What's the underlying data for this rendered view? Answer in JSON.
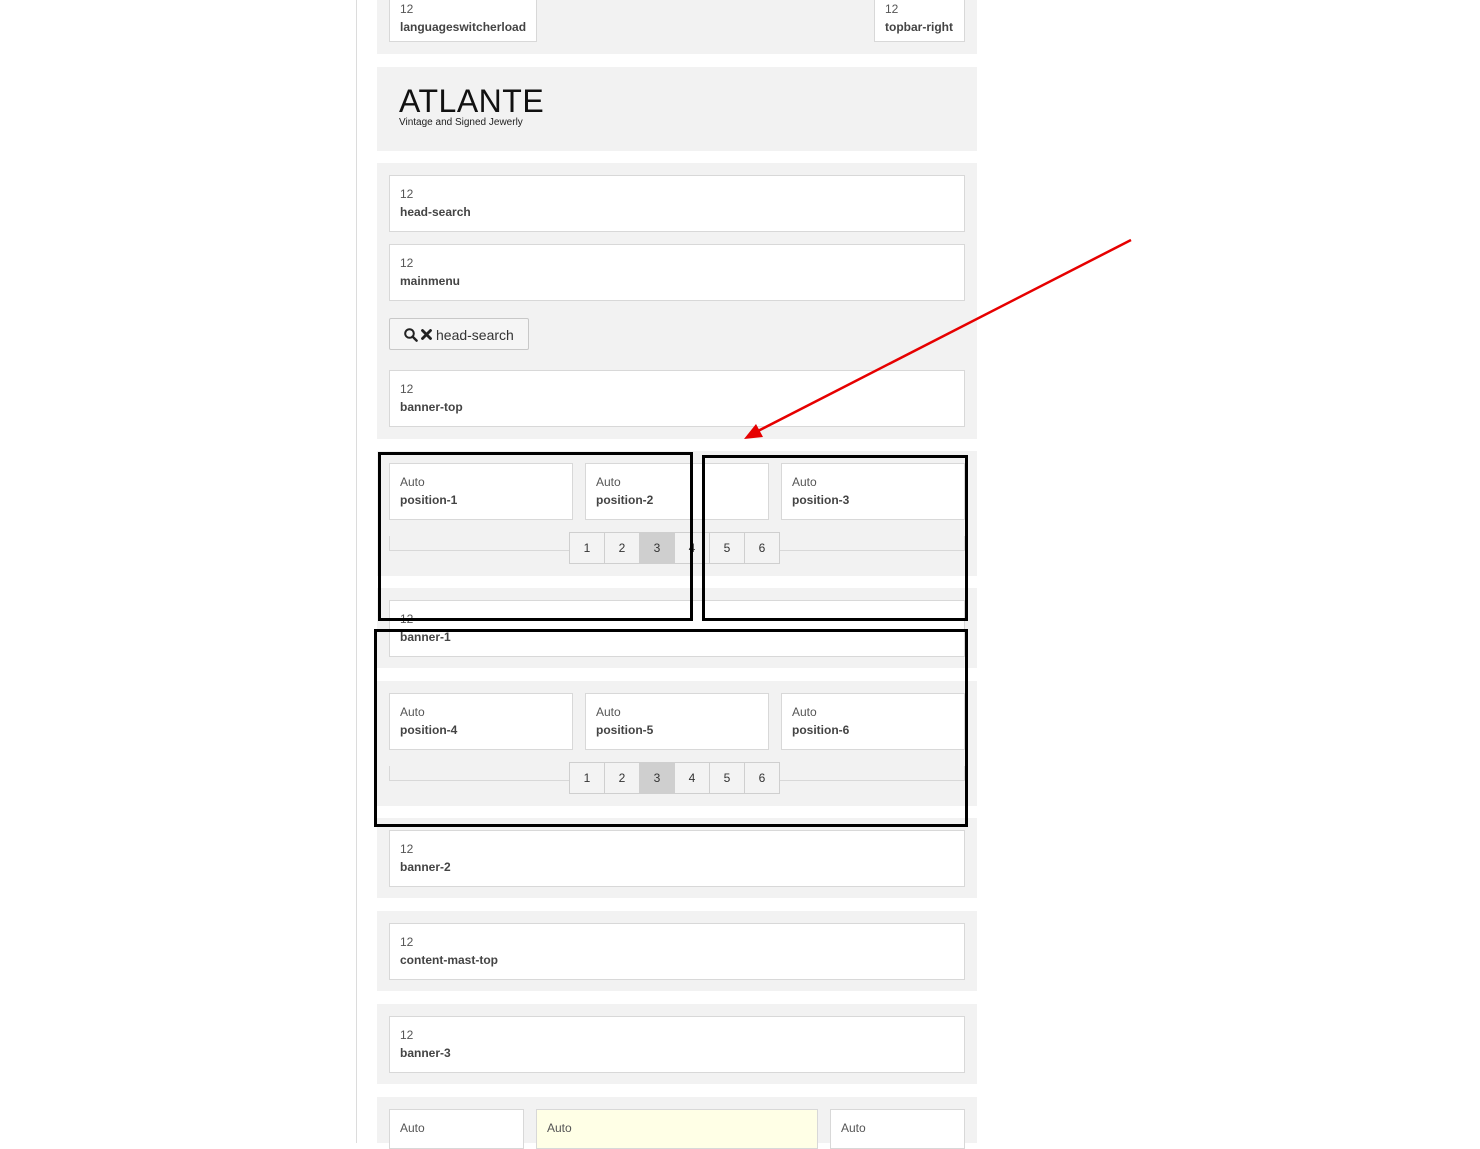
{
  "top_row": {
    "left": {
      "width": "12",
      "name": "languageswitcherload"
    },
    "right": {
      "width": "12",
      "name": "topbar-right"
    }
  },
  "logo": {
    "title": "ATLANTE",
    "subtitle": "Vintage and Signed Jewerly"
  },
  "header_positions": [
    {
      "width": "12",
      "name": "head-search"
    },
    {
      "width": "12",
      "name": "mainmenu"
    }
  ],
  "search_button": {
    "label": "head-search"
  },
  "banner_top": {
    "width": "12",
    "name": "banner-top"
  },
  "row1": {
    "positions": [
      {
        "width": "Auto",
        "name": "position-1"
      },
      {
        "width": "Auto",
        "name": "position-2"
      },
      {
        "width": "Auto",
        "name": "position-3"
      }
    ],
    "pager": [
      "1",
      "2",
      "3",
      "4",
      "5",
      "6"
    ],
    "active": "3"
  },
  "banner_1": {
    "width": "12",
    "name": "banner-1"
  },
  "row2": {
    "positions": [
      {
        "width": "Auto",
        "name": "position-4"
      },
      {
        "width": "Auto",
        "name": "position-5"
      },
      {
        "width": "Auto",
        "name": "position-6"
      }
    ],
    "pager": [
      "1",
      "2",
      "3",
      "4",
      "5",
      "6"
    ],
    "active": "3"
  },
  "banner_2": {
    "width": "12",
    "name": "banner-2"
  },
  "content_mast_top": {
    "width": "12",
    "name": "content-mast-top"
  },
  "banner_3": {
    "width": "12",
    "name": "banner-3"
  },
  "bottom_row": [
    "Auto",
    "Auto",
    "Auto"
  ],
  "colors": {
    "section_bg": "#f2f2f2",
    "highlight_box": "#ffffe6",
    "arrow": "#e60000",
    "annotation": "#000000"
  }
}
